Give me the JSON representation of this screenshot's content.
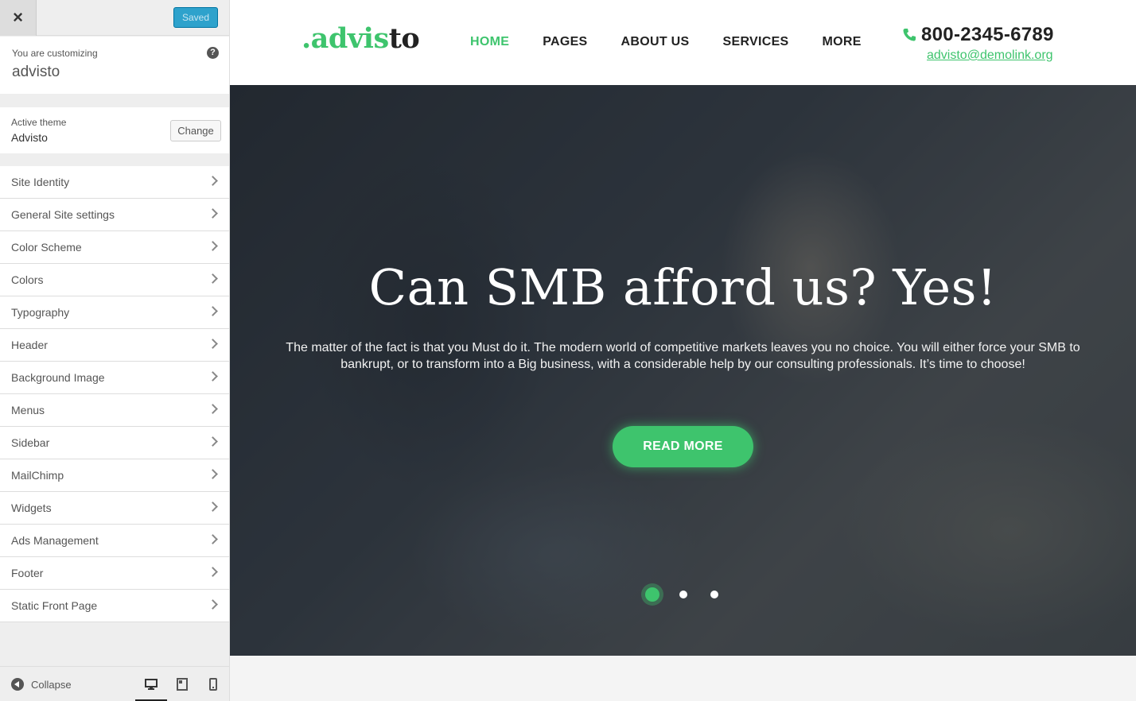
{
  "customizer": {
    "close_label": "×",
    "save_label": "Saved",
    "customizing_label": "You are customizing",
    "site_name": "advisto",
    "help_label": "?",
    "active_theme_label": "Active theme",
    "active_theme_name": "Advisto",
    "change_label": "Change",
    "sections": [
      "Site Identity",
      "General Site settings",
      "Color Scheme",
      "Colors",
      "Typography",
      "Header",
      "Background Image",
      "Menus",
      "Sidebar",
      "MailChimp",
      "Widgets",
      "Ads Management",
      "Footer",
      "Static Front Page"
    ],
    "collapse_label": "Collapse"
  },
  "site": {
    "logo_prefix": ".advis",
    "logo_suffix": "to",
    "nav": [
      "HOME",
      "PAGES",
      "ABOUT US",
      "SERVICES",
      "MORE"
    ],
    "phone": "800-2345-6789",
    "email": "advisto@demolink.org",
    "accent_color": "#3ec46d"
  },
  "hero": {
    "title": "Can SMB afford us? Yes!",
    "text": "The matter of the fact is that you Must do it. The modern world of competitive markets leaves you no choice. You will either force your SMB to bankrupt, or to transform into a Big business, with a considerable help by our consulting professionals. It’s time to choose!",
    "button_label": "READ MORE",
    "slides": 3,
    "active_slide": 1
  }
}
